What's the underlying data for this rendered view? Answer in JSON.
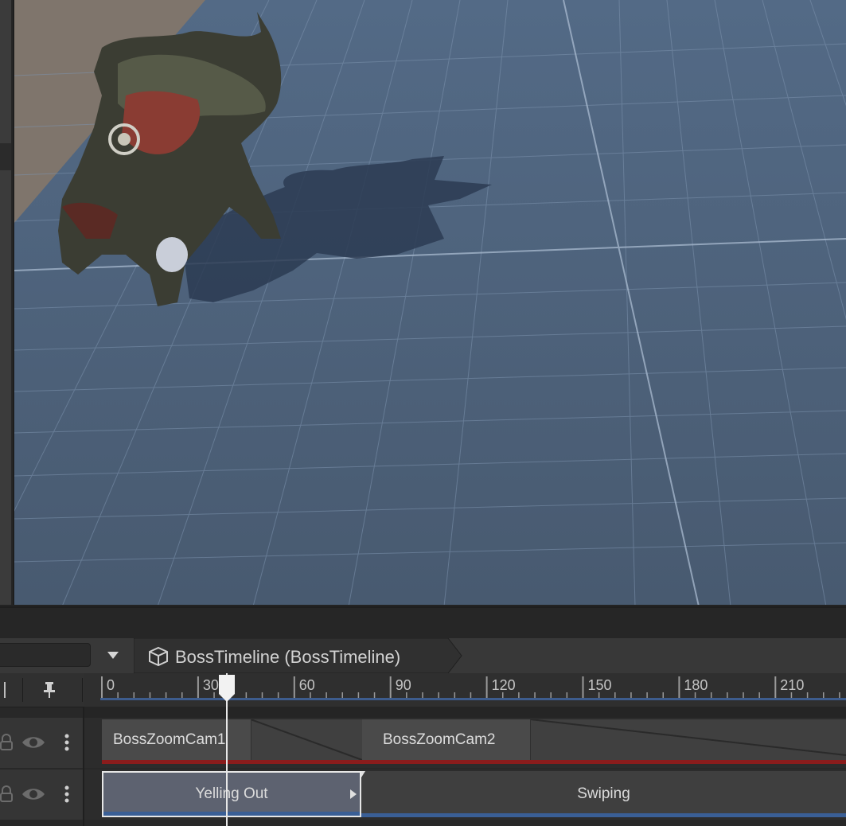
{
  "timeline": {
    "title": "BossTimeline (BossTimeline)",
    "playhead_frame": 38,
    "ruler": {
      "ticks": [
        {
          "label": "0",
          "frame": 0
        },
        {
          "label": "30",
          "frame": 30
        },
        {
          "label": "60",
          "frame": 60
        },
        {
          "label": "90",
          "frame": 90
        },
        {
          "label": "120",
          "frame": 120
        },
        {
          "label": "150",
          "frame": 150
        },
        {
          "label": "180",
          "frame": 180
        },
        {
          "label": "210",
          "frame": 210
        }
      ]
    },
    "tracks": [
      {
        "type": "cinemachine",
        "clips": [
          {
            "label": "BossZoomCam1"
          },
          {
            "label": "BossZoomCam2"
          }
        ],
        "color": "#8a1c1c"
      },
      {
        "type": "animation",
        "clips": [
          {
            "label": "Yelling Out",
            "selected": true
          },
          {
            "label": "Swiping"
          }
        ],
        "color": "#3a5f96"
      }
    ]
  },
  "icons": {
    "pin": "pin-icon",
    "dropdown": "triangle-down-icon",
    "timeline_asset": "cube-icon",
    "lock": "lock-icon",
    "visibility": "eye-icon",
    "menu": "kebab-menu-icon"
  },
  "colors": {
    "scene_background": "#4d6077",
    "grid_line": "#8aa0ba",
    "cinemachine_track": "#8a1c1c",
    "animation_track": "#3a5f96",
    "selection_outline": "#e6e6e6"
  }
}
